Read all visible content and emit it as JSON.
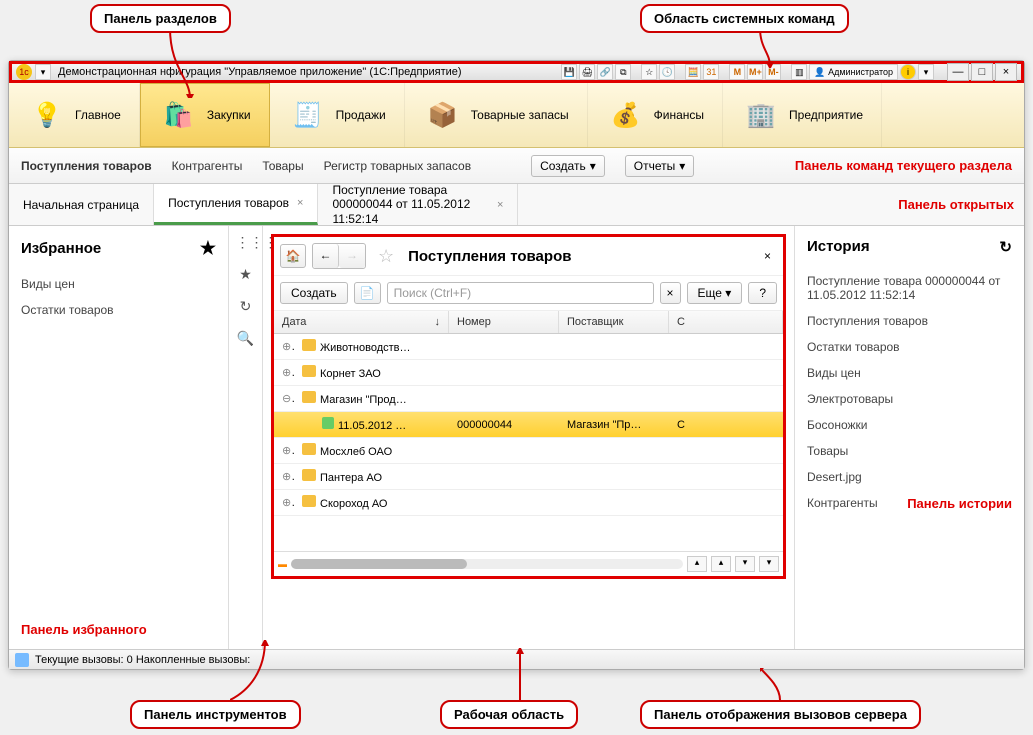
{
  "callouts": {
    "sections": "Панель разделов",
    "syscommands": "Область системных команд",
    "commandsbar": "Панель команд текущего раздела",
    "opentabs": "Панель открытых",
    "favorites": "Панель избранного",
    "tools": "Панель инструментов",
    "workarea": "Рабочая область",
    "servercalls": "Панель отображения вызовов сервера",
    "history": "Панель истории"
  },
  "titlebar": {
    "title": "Демонстрационная          нфигурация \"Управляемое приложение\" (1С:Предприятие)",
    "m": "M",
    "mplus": "M+",
    "mminus": "M-",
    "user": "Администратор"
  },
  "sections": [
    {
      "label": "Главное",
      "icon": "🔵"
    },
    {
      "label": "Закупки",
      "icon": "🛍️",
      "active": true
    },
    {
      "label": "Продажи",
      "icon": "🧾"
    },
    {
      "label": "Товарные запасы",
      "icon": "📦"
    },
    {
      "label": "Финансы",
      "icon": "💰"
    },
    {
      "label": "Предприятие",
      "icon": "🏢"
    }
  ],
  "commands": {
    "links": [
      "Поступления товаров",
      "Контрагенты",
      "Товары",
      "Регистр товарных запасов"
    ],
    "create": "Создать",
    "reports": "Отчеты"
  },
  "tabs": [
    {
      "label": "Начальная страница"
    },
    {
      "label": "Поступления товаров",
      "active": true,
      "closable": true
    },
    {
      "label": "Поступление товара 000000044 от 11.05.2012 11:52:14",
      "closable": true
    }
  ],
  "favorites": {
    "title": "Избранное",
    "items": [
      "Виды цен",
      "Остатки товаров"
    ]
  },
  "workframe": {
    "title": "Поступления товаров",
    "create": "Создать",
    "search_placeholder": "Поиск (Ctrl+F)",
    "more": "Еще",
    "help": "?",
    "columns": [
      "Дата",
      "Номер",
      "Поставщик",
      "С"
    ],
    "rows": [
      {
        "type": "group",
        "label": "Животноводств…"
      },
      {
        "type": "group",
        "label": "Корнет ЗАО"
      },
      {
        "type": "group",
        "label": "Магазин \"Прод…",
        "open": true
      },
      {
        "type": "doc",
        "date": "11.05.2012 …",
        "num": "000000044",
        "sup": "Магазин \"Пр…",
        "s": "С",
        "selected": true
      },
      {
        "type": "group",
        "label": "Мосхлеб ОАО"
      },
      {
        "type": "group",
        "label": "Пантера АО"
      },
      {
        "type": "group",
        "label": "Скороход АО"
      }
    ]
  },
  "history": {
    "title": "История",
    "items": [
      "Поступление товара 000000044 от 11.05.2012 11:52:14",
      "Поступления товаров",
      "Остатки товаров",
      "Виды цен",
      "Электротовары",
      "Босоножки",
      "Товары",
      "Desert.jpg",
      "Контрагенты"
    ]
  },
  "statusbar": {
    "text": "Текущие вызовы: 0  Накопленные вызовы:"
  }
}
